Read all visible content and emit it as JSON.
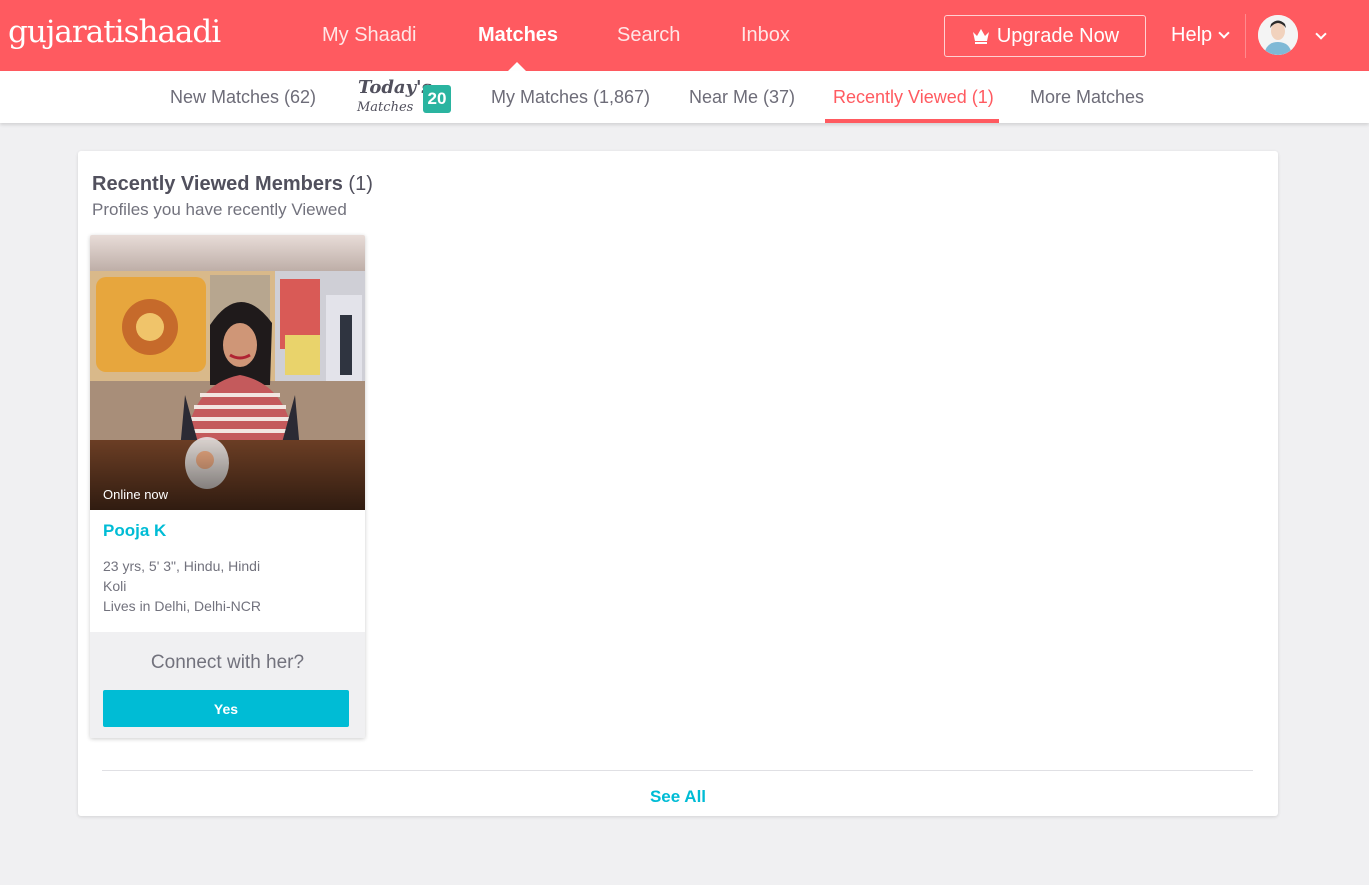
{
  "header": {
    "logo": "gujaratishaadi",
    "nav": [
      "My Shaadi",
      "Matches",
      "Search",
      "Inbox"
    ],
    "active_nav": "Matches",
    "upgrade_label": "Upgrade Now",
    "help_label": "Help",
    "brand_color": "#ff5a60"
  },
  "subnav": {
    "items": [
      "New Matches (62)",
      "My Matches (1,867)",
      "Near Me (37)",
      "Recently Viewed (1)",
      "More Matches"
    ],
    "today_top": "Today's",
    "today_bottom": "Matches",
    "today_count": "20",
    "active": "Recently Viewed (1)"
  },
  "panel": {
    "title": "Recently Viewed Members",
    "count": "(1)",
    "subtitle": "Profiles you have recently Viewed",
    "see_all": "See All"
  },
  "profile": {
    "status": "Online now",
    "name": "Pooja K",
    "details": "23 yrs, 5' 3\", Hindu, Hindi",
    "community": "Koli",
    "location": "Lives in Delhi, Delhi-NCR",
    "connect_question": "Connect with her?",
    "yes_label": "Yes",
    "accent_color": "#00bcd5"
  }
}
